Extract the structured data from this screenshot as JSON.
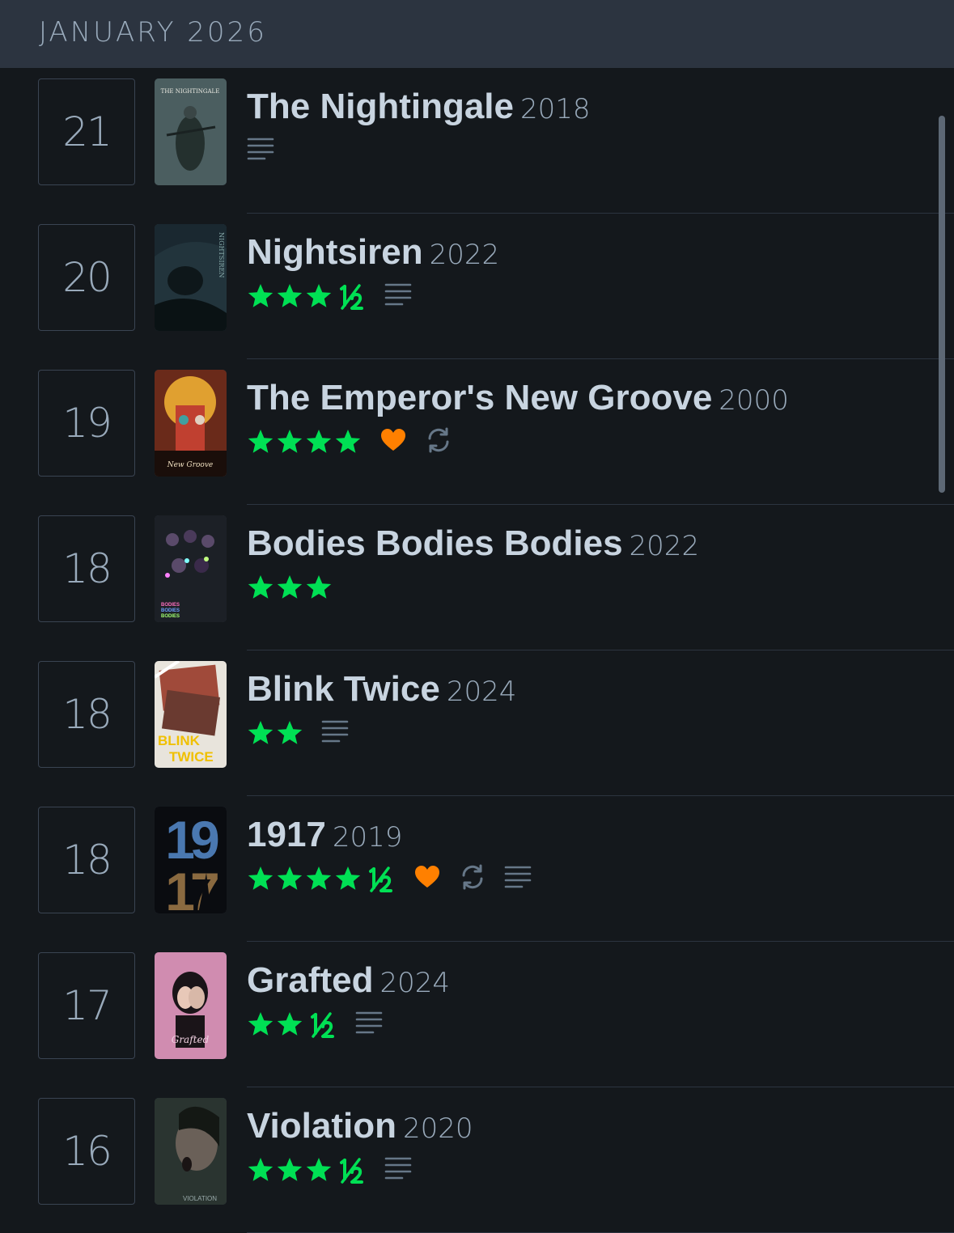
{
  "month_header": {
    "label": "JANUARY 2026"
  },
  "colors": {
    "star": "#00e054",
    "heart": "#ff8000",
    "icon": "#678"
  },
  "entries": [
    {
      "day": "21",
      "title": "The Nightingale",
      "year": "2018",
      "rating": 0,
      "liked": false,
      "rewatch": false,
      "review": true,
      "poster": {
        "bg": "#4b5e60",
        "fg": "#24302e",
        "text": "THE NIGHTINGALE",
        "text_color": "#e8e8e0"
      }
    },
    {
      "day": "20",
      "title": "Nightsiren",
      "year": "2022",
      "rating": 3.5,
      "liked": false,
      "rewatch": false,
      "review": true,
      "poster": {
        "bg": "#22343c",
        "fg": "#0e171a",
        "text": "NIGHTSIREN",
        "text_color": "#8aa"
      }
    },
    {
      "day": "19",
      "title": "The Emperor's New Groove",
      "year": "2000",
      "rating": 4,
      "liked": true,
      "rewatch": true,
      "review": false,
      "poster": {
        "bg": "#6a2a1a",
        "fg": "#e0a030",
        "text": "New Groove",
        "text_color": "#f0e0c0"
      }
    },
    {
      "day": "18",
      "title": "Bodies Bodies Bodies",
      "year": "2022",
      "rating": 3,
      "liked": false,
      "rewatch": false,
      "review": false,
      "poster": {
        "bg": "#1c2026",
        "fg": "#5a4a6a",
        "text": "BODIES BODIES BODIES",
        "text_color": "#c0a0ff"
      }
    },
    {
      "day": "18",
      "title": "Blink Twice",
      "year": "2024",
      "rating": 2,
      "liked": false,
      "rewatch": false,
      "review": true,
      "poster": {
        "bg": "#e8e4dc",
        "fg": "#a04a3a",
        "text": "BLINK TWICE",
        "text_color": "#f0c000"
      }
    },
    {
      "day": "18",
      "title": "1917",
      "year": "2019",
      "rating": 4.5,
      "liked": true,
      "rewatch": true,
      "review": true,
      "poster": {
        "bg": "#0a0c10",
        "fg": "#3c6aa0",
        "text": "1917",
        "text_color": "#4a78b0"
      }
    },
    {
      "day": "17",
      "title": "Grafted",
      "year": "2024",
      "rating": 2.5,
      "liked": false,
      "rewatch": false,
      "review": true,
      "poster": {
        "bg": "#d08cb0",
        "fg": "#1a1418",
        "text": "Grafted",
        "text_color": "#f0d0e0"
      }
    },
    {
      "day": "16",
      "title": "Violation",
      "year": "2020",
      "rating": 3.5,
      "liked": false,
      "rewatch": false,
      "review": true,
      "poster": {
        "bg": "#2a3430",
        "fg": "#6a6058",
        "text": "VIOLATION",
        "text_color": "#9aa"
      }
    }
  ]
}
